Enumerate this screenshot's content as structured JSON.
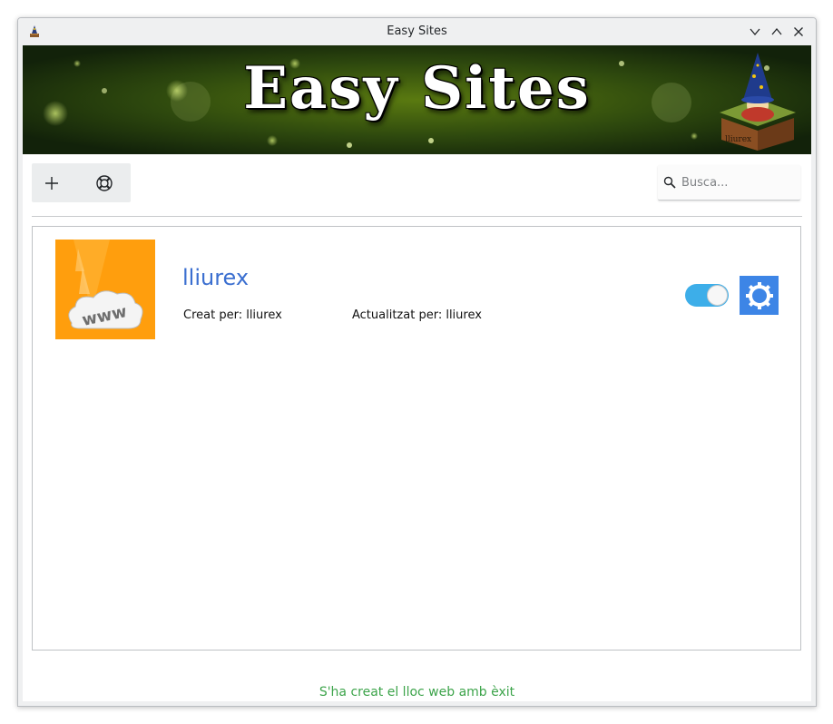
{
  "window": {
    "title": "Easy Sites",
    "controls": [
      "minimize-icon",
      "maximize-icon",
      "close-icon"
    ]
  },
  "banner": {
    "title": "Easy Sites",
    "mascot_box_label": "lliurex"
  },
  "toolbar": {
    "buttons": [
      "add-icon",
      "help-icon"
    ]
  },
  "search": {
    "placeholder": "Busca..."
  },
  "sites": [
    {
      "name": "lliurex",
      "thumbnail_text": "www",
      "created_by": "Creat per: lliurex",
      "updated_by": "Actualitzat per: lliurex",
      "enabled": true
    }
  ],
  "status": {
    "message": "S'ha creat el lloc web amb èxit",
    "color": "#3da44b"
  },
  "colors": {
    "accent": "#3daee9",
    "link": "#3b6fd0",
    "settings_button": "#3d85e6",
    "thumbnail_bg": "#ff9e0d"
  }
}
